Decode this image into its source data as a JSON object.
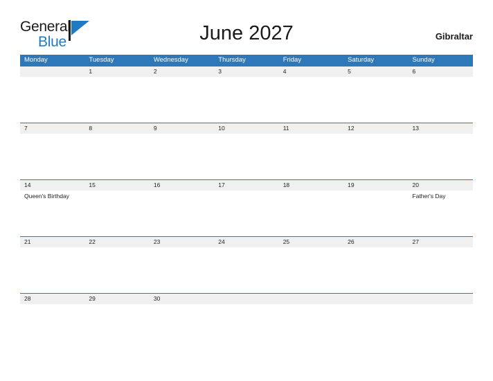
{
  "brand": {
    "name_part1": "General",
    "name_part2": "Blue",
    "flag_icon": "blue-flag-triangle-icon",
    "color_blue": "#1f7ac4",
    "color_dark": "#1a1a1a"
  },
  "header": {
    "title": "June 2027",
    "location": "Gibraltar"
  },
  "theme": {
    "header_bar_color": "#2e77b8",
    "row_band_color": "#f0f0f0",
    "rule_color": "#2e77b8",
    "text_color": "#222222",
    "page_background": "#ffffff"
  },
  "calendar": {
    "month": "June",
    "year": "2027",
    "week_start": "Monday",
    "weekdays": [
      "Monday",
      "Tuesday",
      "Wednesday",
      "Thursday",
      "Friday",
      "Saturday",
      "Sunday"
    ],
    "weeks": [
      [
        {
          "day": "",
          "event": ""
        },
        {
          "day": "1",
          "event": ""
        },
        {
          "day": "2",
          "event": ""
        },
        {
          "day": "3",
          "event": ""
        },
        {
          "day": "4",
          "event": ""
        },
        {
          "day": "5",
          "event": ""
        },
        {
          "day": "6",
          "event": ""
        }
      ],
      [
        {
          "day": "7",
          "event": ""
        },
        {
          "day": "8",
          "event": ""
        },
        {
          "day": "9",
          "event": ""
        },
        {
          "day": "10",
          "event": ""
        },
        {
          "day": "11",
          "event": ""
        },
        {
          "day": "12",
          "event": ""
        },
        {
          "day": "13",
          "event": ""
        }
      ],
      [
        {
          "day": "14",
          "event": "Queen's Birthday"
        },
        {
          "day": "15",
          "event": ""
        },
        {
          "day": "16",
          "event": ""
        },
        {
          "day": "17",
          "event": ""
        },
        {
          "day": "18",
          "event": ""
        },
        {
          "day": "19",
          "event": ""
        },
        {
          "day": "20",
          "event": "Father's Day"
        }
      ],
      [
        {
          "day": "21",
          "event": ""
        },
        {
          "day": "22",
          "event": ""
        },
        {
          "day": "23",
          "event": ""
        },
        {
          "day": "24",
          "event": ""
        },
        {
          "day": "25",
          "event": ""
        },
        {
          "day": "26",
          "event": ""
        },
        {
          "day": "27",
          "event": ""
        }
      ],
      [
        {
          "day": "28",
          "event": ""
        },
        {
          "day": "29",
          "event": ""
        },
        {
          "day": "30",
          "event": ""
        },
        {
          "day": "",
          "event": ""
        },
        {
          "day": "",
          "event": ""
        },
        {
          "day": "",
          "event": ""
        },
        {
          "day": "",
          "event": ""
        }
      ]
    ]
  }
}
